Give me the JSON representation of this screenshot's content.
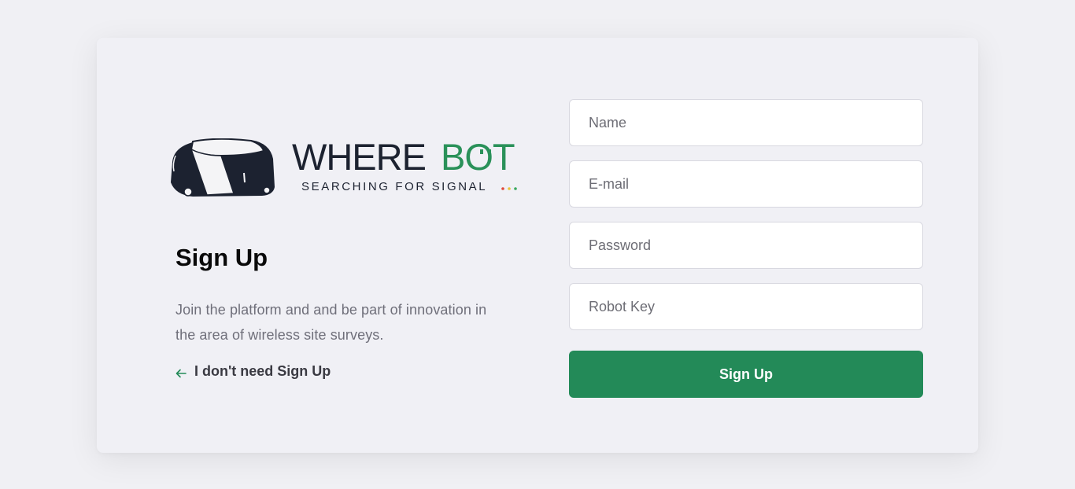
{
  "logo": {
    "name_dark": "WHERE",
    "name_green": "BOT",
    "tagline": "SEARCHING FOR SIGNAL",
    "colors": {
      "dark": "#1c2230",
      "green": "#2a9159",
      "dot_red": "#e04a3a",
      "dot_yellow": "#e8c43a",
      "dot_green": "#3aa85e"
    }
  },
  "intro": {
    "title": "Sign Up",
    "description": "Join the platform and and be part of innovation in the area of wireless site surveys.",
    "back_link_label": "I don't need Sign Up",
    "back_icon": "arrow-left-icon"
  },
  "form": {
    "name_placeholder": "Name",
    "email_placeholder": "E-mail",
    "password_placeholder": "Password",
    "robot_key_placeholder": "Robot Key",
    "submit_label": "Sign Up"
  },
  "colors": {
    "accent": "#238a58",
    "background": "#f0f0f4",
    "card": "#f0f0f5"
  }
}
